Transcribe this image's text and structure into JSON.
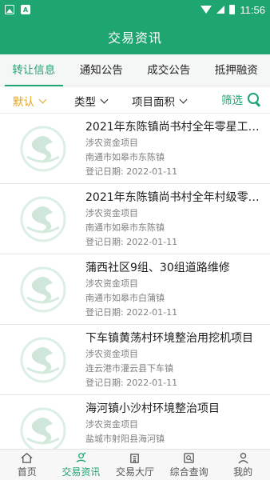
{
  "status_bar": {
    "time": "11:56",
    "icons": [
      "image-icon",
      "text-a-icon",
      "wifi-icon",
      "signal-icon",
      "battery-icon"
    ]
  },
  "app_bar": {
    "title": "交易资讯"
  },
  "tabs": [
    {
      "label": "转让信息",
      "active": true
    },
    {
      "label": "通知公告",
      "active": false
    },
    {
      "label": "成交公告",
      "active": false
    },
    {
      "label": "抵押融资",
      "active": false
    }
  ],
  "filters": {
    "default_label": "默认",
    "type_label": "类型",
    "area_label": "项目面积",
    "screen_label": "筛选"
  },
  "items": [
    {
      "title": "2021年东陈镇尚书村全年零星工…",
      "category": "涉农资金项目",
      "location": "南通市如皋市东陈镇",
      "date": "登记日期: 2022-01-11"
    },
    {
      "title": "2021年东陈镇尚书村全年村级零…",
      "category": "涉农资金项目",
      "location": "南通市如皋市东陈镇",
      "date": "登记日期: 2022-01-11"
    },
    {
      "title": "蒲西社区9组、30组道路维修",
      "category": "涉农资金项目",
      "location": "南通市如皋市白蒲镇",
      "date": "登记日期: 2022-01-11"
    },
    {
      "title": "下车镇黄荡村环境整治用挖机项目",
      "category": "涉农资金项目",
      "location": "连云港市灌云县下车镇",
      "date": "登记日期: 2022-01-11"
    },
    {
      "title": "海河镇小沙村环境整治项目",
      "category": "涉农资金项目",
      "location": "盐城市射阳县海河镇",
      "date": "登记日期: 2022-01-11"
    }
  ],
  "bottom_nav": [
    {
      "label": "首页",
      "icon": "home-icon",
      "active": false
    },
    {
      "label": "交易资讯",
      "icon": "news-icon",
      "active": true
    },
    {
      "label": "交易大厅",
      "icon": "building-icon",
      "active": false
    },
    {
      "label": "综合查询",
      "icon": "query-icon",
      "active": false
    },
    {
      "label": "我的",
      "icon": "user-icon",
      "active": false
    }
  ],
  "colors": {
    "primary": "#1fa56f",
    "filter_active": "#e7a31a",
    "thumb_tint": "#d8ece2"
  }
}
